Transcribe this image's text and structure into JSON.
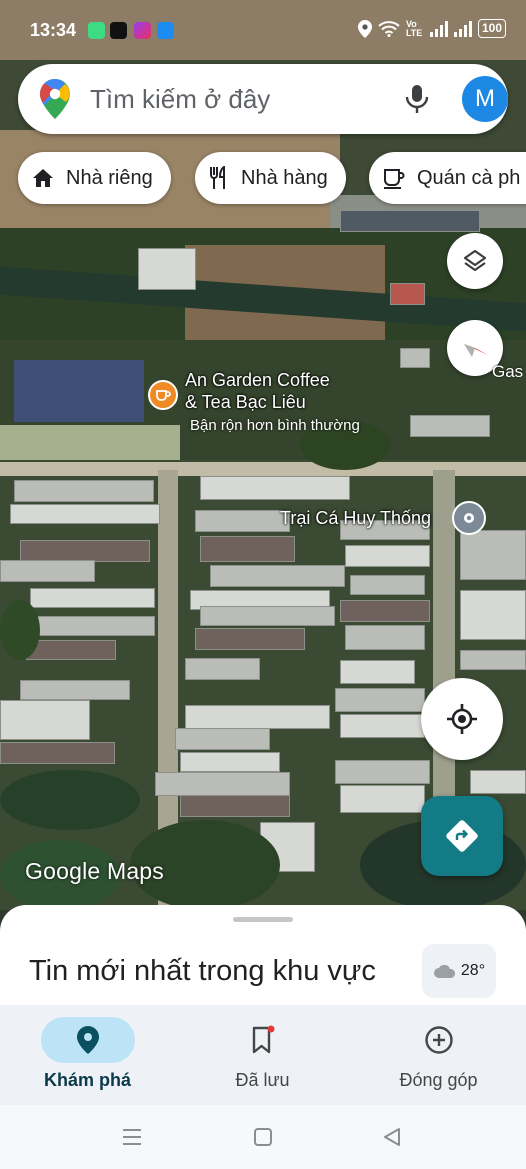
{
  "status_bar": {
    "time": "13:34",
    "network_label": "Vo LTE",
    "battery": "100",
    "icons": [
      "android-app-icon",
      "tiktok-icon",
      "messenger-icon",
      "camera-app-icon",
      "location-icon",
      "wifi-icon",
      "signal-icon",
      "signal-icon",
      "battery-icon"
    ]
  },
  "search": {
    "placeholder": "Tìm kiếm ở đây",
    "avatar_letter": "M",
    "icons": [
      "google-maps-pin-icon",
      "microphone-icon"
    ]
  },
  "chips": [
    {
      "label": "Nhà riêng",
      "icon": "home-icon"
    },
    {
      "label": "Nhà hàng",
      "icon": "restaurant-icon"
    },
    {
      "label": "Quán cà ph",
      "icon": "coffee-icon"
    }
  ],
  "map": {
    "layers_icon": "layers-icon",
    "compass_icon": "compass-icon",
    "gas_label": "Gas",
    "poi_coffee": {
      "title_line1": "An Garden Coffee",
      "title_line2": "& Tea Bạc Liêu",
      "subtitle": "Bận rộn hơn bình thường",
      "icon": "coffee-cup-icon"
    },
    "poi_fish_farm": {
      "title": "Trại Cá Huy Thống",
      "icon": "place-pin-icon"
    },
    "watermark": "Google Maps",
    "my_location_icon": "my-location-icon",
    "directions_icon": "directions-icon"
  },
  "sheet": {
    "title": "Tin mới nhất trong khu vực",
    "weather_temp": "28°",
    "weather_icon": "cloud-icon"
  },
  "bottom_nav": [
    {
      "label": "Khám phá",
      "icon": "explore-pin-icon",
      "active": true
    },
    {
      "label": "Đã lưu",
      "icon": "bookmark-icon",
      "active": false
    },
    {
      "label": "Đóng góp",
      "icon": "add-circle-icon",
      "active": false
    }
  ],
  "colors": {
    "accent": "#127b85",
    "active_pill": "#bde3f6",
    "avatar": "#1e88e5"
  }
}
